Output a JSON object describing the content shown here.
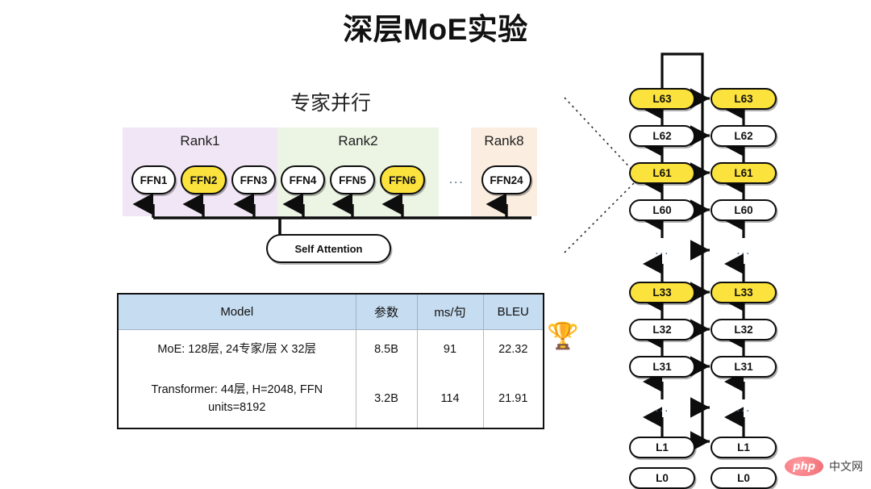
{
  "page": {
    "title": "深层MoE实验"
  },
  "expert_parallel": {
    "section_title": "专家并行",
    "ranks": [
      {
        "label": "Rank1",
        "color": "#f1e6f5"
      },
      {
        "label": "Rank2",
        "color": "#ecf4e4"
      },
      {
        "label": "Rank8",
        "color": "#fbeee1"
      }
    ],
    "experts": [
      {
        "label": "FFN1",
        "highlighted": false
      },
      {
        "label": "FFN2",
        "highlighted": true
      },
      {
        "label": "FFN3",
        "highlighted": false
      },
      {
        "label": "FFN4",
        "highlighted": false
      },
      {
        "label": "FFN5",
        "highlighted": false
      },
      {
        "label": "FFN6",
        "highlighted": true
      },
      {
        "label": "FFN24",
        "highlighted": false
      }
    ],
    "gap_ellipsis": "...",
    "attention_label": "Self Attention",
    "highlight_color": "#fbe23c"
  },
  "results_table": {
    "columns": [
      "Model",
      "参数",
      "ms/句",
      "BLEU"
    ],
    "header_color": "#c6dcf0",
    "rows": [
      {
        "model": "MoE: 128层, 24专家/层 X 32层",
        "params": "8.5B",
        "ms_per_sentence": "91",
        "bleu": "22.32"
      },
      {
        "model": "Transformer: 44层, H=2048, FFN units=8192",
        "params": "3.2B",
        "ms_per_sentence": "114",
        "bleu": "21.91"
      }
    ],
    "winner_badge": "🏆"
  },
  "layer_stack": {
    "ellipsis": "...",
    "left_column": [
      {
        "label": "L63",
        "highlighted": true
      },
      {
        "label": "L62",
        "highlighted": false
      },
      {
        "label": "L61",
        "highlighted": true
      },
      {
        "label": "L60",
        "highlighted": false
      },
      {
        "label": "L33",
        "highlighted": true
      },
      {
        "label": "L32",
        "highlighted": false
      },
      {
        "label": "L31",
        "highlighted": false
      },
      {
        "label": "L1",
        "highlighted": false
      },
      {
        "label": "L0",
        "highlighted": false
      }
    ],
    "right_column": [
      {
        "label": "L63",
        "highlighted": true
      },
      {
        "label": "L62",
        "highlighted": false
      },
      {
        "label": "L61",
        "highlighted": true
      },
      {
        "label": "L60",
        "highlighted": false
      },
      {
        "label": "L33",
        "highlighted": true
      },
      {
        "label": "L32",
        "highlighted": false
      },
      {
        "label": "L31",
        "highlighted": false
      },
      {
        "label": "L1",
        "highlighted": false
      },
      {
        "label": "L0",
        "highlighted": false
      }
    ]
  },
  "watermark": {
    "logo_text": "php",
    "text": "中文网",
    "color": "#ef6b72"
  }
}
